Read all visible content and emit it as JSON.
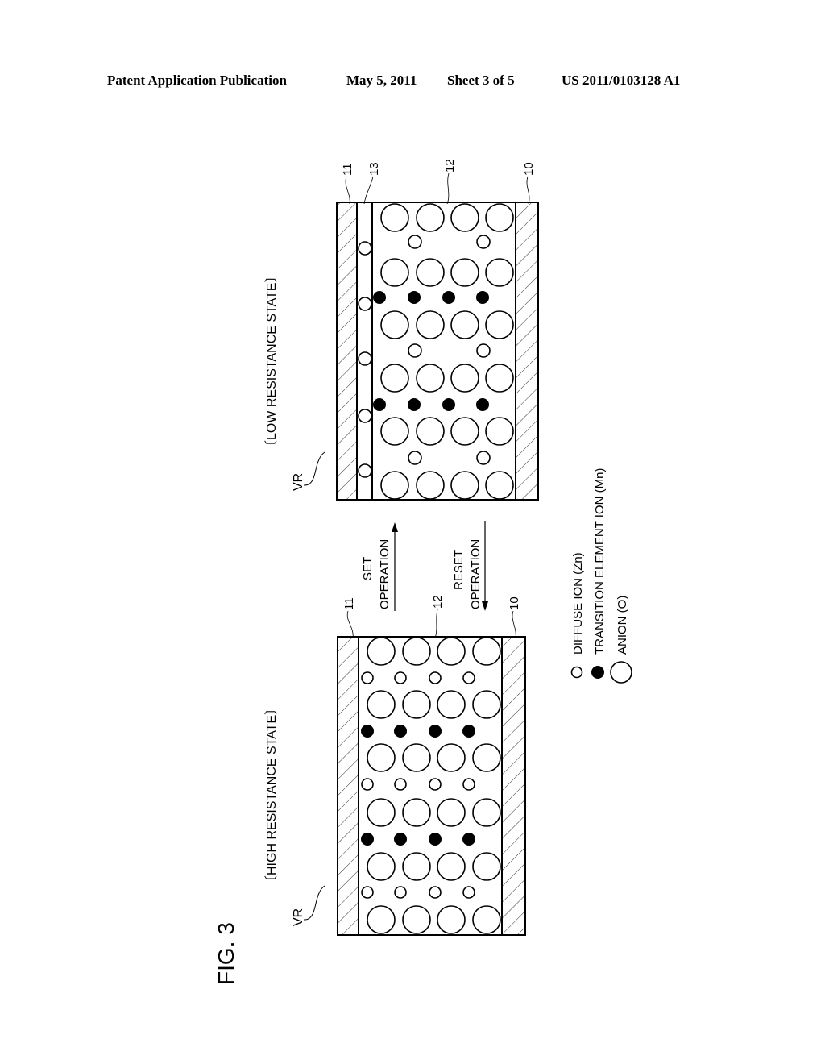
{
  "header": {
    "publication": "Patent Application Publication",
    "date": "May 5, 2011",
    "sheet": "Sheet 3 of 5",
    "number": "US 2011/0103128 A1"
  },
  "figure": {
    "label": "FIG. 3",
    "high_state": {
      "title": "〔HIGH RESISTANCE STATE〕",
      "vr_label": "VR",
      "ref_top": "11",
      "ref_mid": "12",
      "ref_bottom": "10"
    },
    "low_state": {
      "title": "〔LOW RESISTANCE STATE〕",
      "vr_label": "VR",
      "ref_top": "11",
      "ref_layer": "13",
      "ref_mid": "12",
      "ref_bottom": "10"
    },
    "set_op": {
      "line1": "SET",
      "line2": "OPERATION"
    },
    "reset_op": {
      "line1": "RESET",
      "line2": "OPERATION"
    },
    "legend": [
      {
        "icon": "small-open-circle",
        "label": "DIFFUSE ION (Zn)"
      },
      {
        "icon": "filled-circle",
        "label": "TRANSITION ELEMENT ION (Mn)"
      },
      {
        "icon": "large-open-circle",
        "label": "ANION (O)"
      }
    ]
  }
}
